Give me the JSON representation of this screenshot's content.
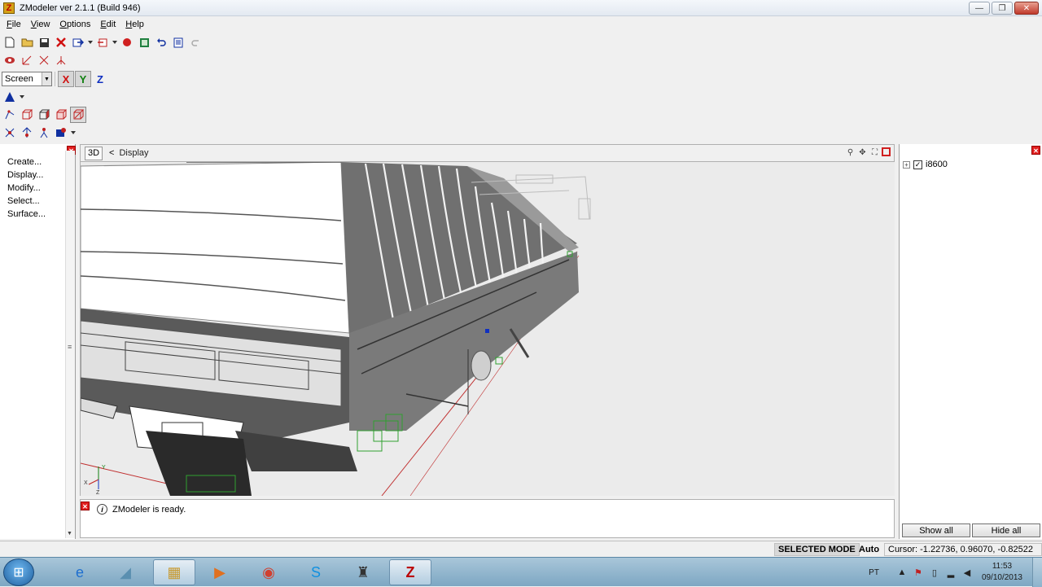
{
  "window": {
    "title": "ZModeler ver 2.1.1 (Build 946)",
    "app_icon": "Z",
    "min": "—",
    "max": "❐",
    "close": "✕"
  },
  "menu": [
    {
      "label": "File",
      "key": "F",
      "rest": "ile"
    },
    {
      "label": "View",
      "key": "V",
      "rest": "iew"
    },
    {
      "label": "Options",
      "key": "O",
      "rest": "ptions"
    },
    {
      "label": "Edit",
      "key": "E",
      "rest": "dit"
    },
    {
      "label": "Help",
      "key": "H",
      "rest": "elp"
    }
  ],
  "toolbar": {
    "coord_space": "Screen",
    "axis_x": "X",
    "axis_y": "Y",
    "axis_z": "Z"
  },
  "left_panel": {
    "commands": [
      "Create...",
      "Display...",
      "Modify...",
      "Select...",
      "Surface..."
    ]
  },
  "viewport": {
    "mode": "3D",
    "nav_arrow": "<",
    "name": "Display",
    "axes": {
      "x": "X",
      "y": "Y",
      "z": "Z"
    }
  },
  "log": {
    "message": "ZModeler is ready.",
    "icon": "i"
  },
  "scene_tree": {
    "items": [
      {
        "label": "i8600",
        "checked": true,
        "expander": "+"
      }
    ],
    "show_all": "Show all",
    "hide_all": "Hide all"
  },
  "status": {
    "mode": "SELECTED MODE",
    "auto": "Auto",
    "cursor": "Cursor: -1.22736, 0.96070, -0.82522"
  },
  "taskbar": {
    "language": "PT",
    "time": "11:53",
    "date": "09/10/2013",
    "apps": [
      "internet-explorer",
      "file-explorer-alt",
      "folders",
      "media-player",
      "chrome",
      "skype",
      "tool",
      "zmodeler"
    ]
  },
  "colors": {
    "accent_red": "#d01010",
    "axis_green": "#108010",
    "axis_blue": "#1030c0",
    "taskbar": "#7da7c3"
  }
}
